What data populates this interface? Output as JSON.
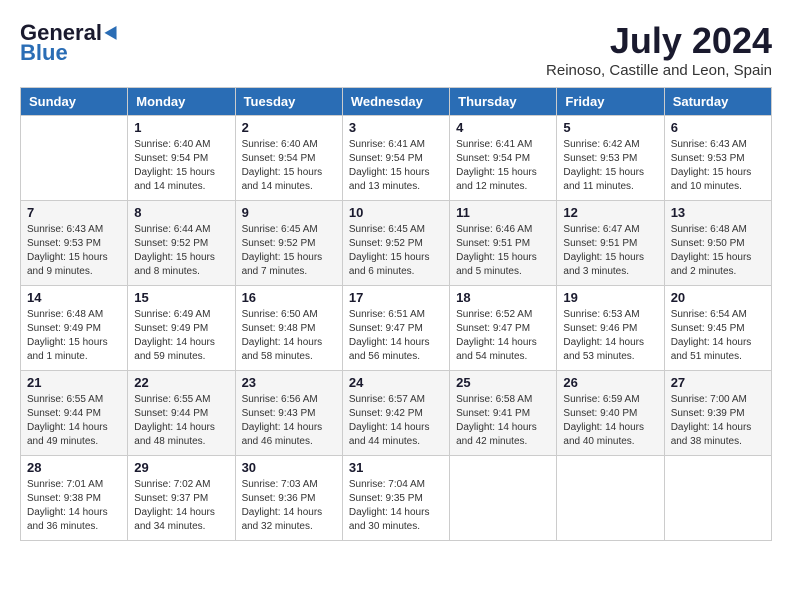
{
  "logo": {
    "general": "General",
    "blue": "Blue"
  },
  "title": {
    "month_year": "July 2024",
    "location": "Reinoso, Castille and Leon, Spain"
  },
  "days_of_week": [
    "Sunday",
    "Monday",
    "Tuesday",
    "Wednesday",
    "Thursday",
    "Friday",
    "Saturday"
  ],
  "weeks": [
    [
      {
        "day": "",
        "sunrise": "",
        "sunset": "",
        "daylight": ""
      },
      {
        "day": "1",
        "sunrise": "Sunrise: 6:40 AM",
        "sunset": "Sunset: 9:54 PM",
        "daylight": "Daylight: 15 hours and 14 minutes."
      },
      {
        "day": "2",
        "sunrise": "Sunrise: 6:40 AM",
        "sunset": "Sunset: 9:54 PM",
        "daylight": "Daylight: 15 hours and 14 minutes."
      },
      {
        "day": "3",
        "sunrise": "Sunrise: 6:41 AM",
        "sunset": "Sunset: 9:54 PM",
        "daylight": "Daylight: 15 hours and 13 minutes."
      },
      {
        "day": "4",
        "sunrise": "Sunrise: 6:41 AM",
        "sunset": "Sunset: 9:54 PM",
        "daylight": "Daylight: 15 hours and 12 minutes."
      },
      {
        "day": "5",
        "sunrise": "Sunrise: 6:42 AM",
        "sunset": "Sunset: 9:53 PM",
        "daylight": "Daylight: 15 hours and 11 minutes."
      },
      {
        "day": "6",
        "sunrise": "Sunrise: 6:43 AM",
        "sunset": "Sunset: 9:53 PM",
        "daylight": "Daylight: 15 hours and 10 minutes."
      }
    ],
    [
      {
        "day": "7",
        "sunrise": "Sunrise: 6:43 AM",
        "sunset": "Sunset: 9:53 PM",
        "daylight": "Daylight: 15 hours and 9 minutes."
      },
      {
        "day": "8",
        "sunrise": "Sunrise: 6:44 AM",
        "sunset": "Sunset: 9:52 PM",
        "daylight": "Daylight: 15 hours and 8 minutes."
      },
      {
        "day": "9",
        "sunrise": "Sunrise: 6:45 AM",
        "sunset": "Sunset: 9:52 PM",
        "daylight": "Daylight: 15 hours and 7 minutes."
      },
      {
        "day": "10",
        "sunrise": "Sunrise: 6:45 AM",
        "sunset": "Sunset: 9:52 PM",
        "daylight": "Daylight: 15 hours and 6 minutes."
      },
      {
        "day": "11",
        "sunrise": "Sunrise: 6:46 AM",
        "sunset": "Sunset: 9:51 PM",
        "daylight": "Daylight: 15 hours and 5 minutes."
      },
      {
        "day": "12",
        "sunrise": "Sunrise: 6:47 AM",
        "sunset": "Sunset: 9:51 PM",
        "daylight": "Daylight: 15 hours and 3 minutes."
      },
      {
        "day": "13",
        "sunrise": "Sunrise: 6:48 AM",
        "sunset": "Sunset: 9:50 PM",
        "daylight": "Daylight: 15 hours and 2 minutes."
      }
    ],
    [
      {
        "day": "14",
        "sunrise": "Sunrise: 6:48 AM",
        "sunset": "Sunset: 9:49 PM",
        "daylight": "Daylight: 15 hours and 1 minute."
      },
      {
        "day": "15",
        "sunrise": "Sunrise: 6:49 AM",
        "sunset": "Sunset: 9:49 PM",
        "daylight": "Daylight: 14 hours and 59 minutes."
      },
      {
        "day": "16",
        "sunrise": "Sunrise: 6:50 AM",
        "sunset": "Sunset: 9:48 PM",
        "daylight": "Daylight: 14 hours and 58 minutes."
      },
      {
        "day": "17",
        "sunrise": "Sunrise: 6:51 AM",
        "sunset": "Sunset: 9:47 PM",
        "daylight": "Daylight: 14 hours and 56 minutes."
      },
      {
        "day": "18",
        "sunrise": "Sunrise: 6:52 AM",
        "sunset": "Sunset: 9:47 PM",
        "daylight": "Daylight: 14 hours and 54 minutes."
      },
      {
        "day": "19",
        "sunrise": "Sunrise: 6:53 AM",
        "sunset": "Sunset: 9:46 PM",
        "daylight": "Daylight: 14 hours and 53 minutes."
      },
      {
        "day": "20",
        "sunrise": "Sunrise: 6:54 AM",
        "sunset": "Sunset: 9:45 PM",
        "daylight": "Daylight: 14 hours and 51 minutes."
      }
    ],
    [
      {
        "day": "21",
        "sunrise": "Sunrise: 6:55 AM",
        "sunset": "Sunset: 9:44 PM",
        "daylight": "Daylight: 14 hours and 49 minutes."
      },
      {
        "day": "22",
        "sunrise": "Sunrise: 6:55 AM",
        "sunset": "Sunset: 9:44 PM",
        "daylight": "Daylight: 14 hours and 48 minutes."
      },
      {
        "day": "23",
        "sunrise": "Sunrise: 6:56 AM",
        "sunset": "Sunset: 9:43 PM",
        "daylight": "Daylight: 14 hours and 46 minutes."
      },
      {
        "day": "24",
        "sunrise": "Sunrise: 6:57 AM",
        "sunset": "Sunset: 9:42 PM",
        "daylight": "Daylight: 14 hours and 44 minutes."
      },
      {
        "day": "25",
        "sunrise": "Sunrise: 6:58 AM",
        "sunset": "Sunset: 9:41 PM",
        "daylight": "Daylight: 14 hours and 42 minutes."
      },
      {
        "day": "26",
        "sunrise": "Sunrise: 6:59 AM",
        "sunset": "Sunset: 9:40 PM",
        "daylight": "Daylight: 14 hours and 40 minutes."
      },
      {
        "day": "27",
        "sunrise": "Sunrise: 7:00 AM",
        "sunset": "Sunset: 9:39 PM",
        "daylight": "Daylight: 14 hours and 38 minutes."
      }
    ],
    [
      {
        "day": "28",
        "sunrise": "Sunrise: 7:01 AM",
        "sunset": "Sunset: 9:38 PM",
        "daylight": "Daylight: 14 hours and 36 minutes."
      },
      {
        "day": "29",
        "sunrise": "Sunrise: 7:02 AM",
        "sunset": "Sunset: 9:37 PM",
        "daylight": "Daylight: 14 hours and 34 minutes."
      },
      {
        "day": "30",
        "sunrise": "Sunrise: 7:03 AM",
        "sunset": "Sunset: 9:36 PM",
        "daylight": "Daylight: 14 hours and 32 minutes."
      },
      {
        "day": "31",
        "sunrise": "Sunrise: 7:04 AM",
        "sunset": "Sunset: 9:35 PM",
        "daylight": "Daylight: 14 hours and 30 minutes."
      },
      {
        "day": "",
        "sunrise": "",
        "sunset": "",
        "daylight": ""
      },
      {
        "day": "",
        "sunrise": "",
        "sunset": "",
        "daylight": ""
      },
      {
        "day": "",
        "sunrise": "",
        "sunset": "",
        "daylight": ""
      }
    ]
  ]
}
